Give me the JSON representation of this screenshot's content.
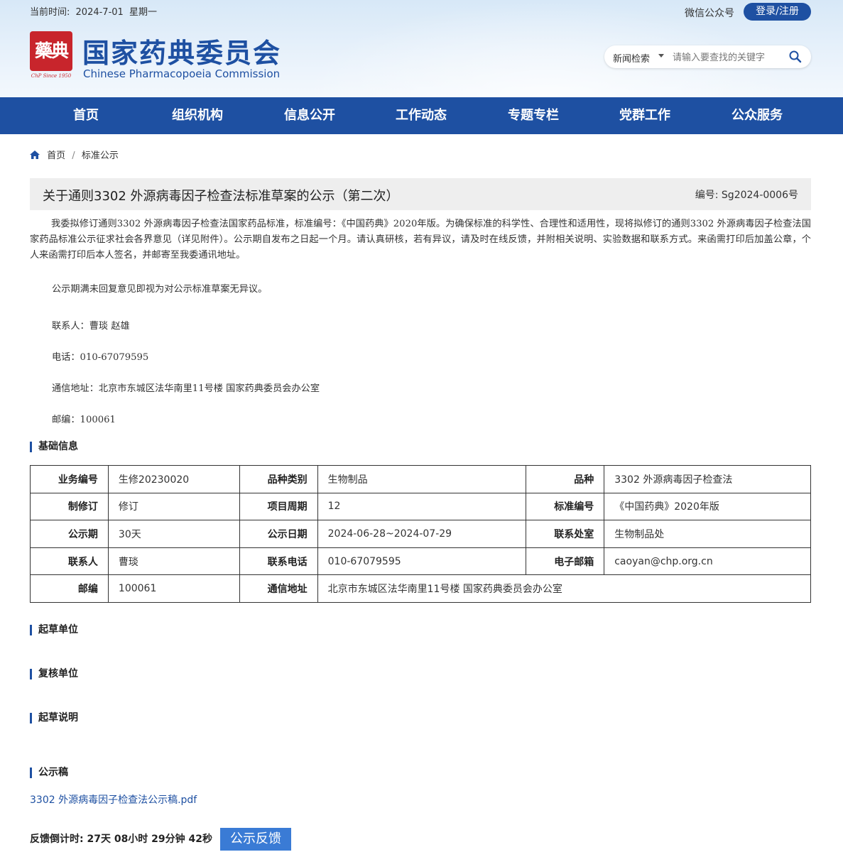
{
  "header": {
    "date_label": "当前时间:",
    "date_value": "2024-7-01",
    "weekday": "星期一",
    "seal_text": "藥典",
    "seal_sub": "ChP Since 1950",
    "site_title": "国家药典委员会",
    "site_title_en": "Chinese Pharmacopoeia Commission",
    "wechat": "微信公众号",
    "login": "登录/注册",
    "search_select": "新闻检索",
    "search_placeholder": "请输入要查找的关键字"
  },
  "nav": [
    "首页",
    "组织机构",
    "信息公开",
    "工作动态",
    "专题专栏",
    "党群工作",
    "公众服务"
  ],
  "breadcrumb": {
    "home": "首页",
    "sep": "/",
    "current": "标准公示"
  },
  "article": {
    "title": "关于通则3302 外源病毒因子检查法标准草案的公示（第二次）",
    "code": "编号: Sg2024-0006号",
    "para1": "我委拟修订通则3302 外源病毒因子检查法国家药品标准，标准编号：《中国药典》2020年版。为确保标准的科学性、合理性和适用性，现将拟修订的通则3302 外源病毒因子检查法国家药品标准公示征求社会各界意见（详见附件）。公示期自发布之日起一个月。请认真研核，若有异议，请及时在线反馈，并附相关说明、实验数据和联系方式。来函需打印后加盖公章，个人来函需打印后本人签名，并邮寄至我委通讯地址。",
    "para2": "公示期满未回复意见即视为对公示标准草案无异议。",
    "contact": "联系人：曹琰 赵雄",
    "phone": "电话：010-67079595",
    "address": "通信地址：北京市东城区法华南里11号楼 国家药典委员会办公室",
    "postcode": "邮编：100061"
  },
  "sections": {
    "basic": "基础信息",
    "drafter": "起草单位",
    "reviewer": "复核单位",
    "draft_note": "起草说明",
    "notice_doc": "公示稿"
  },
  "table": {
    "r1": {
      "l1": "业务编号",
      "v1": "生修20230020",
      "l2": "品种类别",
      "v2": "生物制品",
      "l3": "品种",
      "v3": "3302 外源病毒因子检查法"
    },
    "r2": {
      "l1": "制修订",
      "v1": "修订",
      "l2": "项目周期",
      "v2": "12",
      "l3": "标准编号",
      "v3": "《中国药典》2020年版"
    },
    "r3": {
      "l1": "公示期",
      "v1": "30天",
      "l2": "公示日期",
      "v2": "2024-06-28~2024-07-29",
      "l3": "联系处室",
      "v3": "生物制品处"
    },
    "r4": {
      "l1": "联系人",
      "v1": "曹琰",
      "l2": "联系电话",
      "v2": "010-67079595",
      "l3": "电子邮箱",
      "v3": "caoyan@chp.org.cn"
    },
    "r5": {
      "l1": "邮编",
      "v1": "100061",
      "l2": "通信地址",
      "v2": "北京市东城区法华南里11号楼 国家药典委员会办公室"
    }
  },
  "attachment": "3302 外源病毒因子检查法公示稿.pdf",
  "countdown": "反馈倒计时:  27天 08小时 29分钟 42秒",
  "feedback_button": "公示反馈",
  "colors": {
    "primary": "#1e50a2",
    "seal": "#c8252c",
    "button": "#3a7bd5"
  }
}
